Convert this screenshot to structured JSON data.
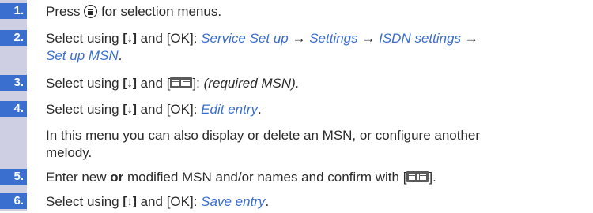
{
  "steps": [
    {
      "num": "1.",
      "before": "Press",
      "after": "for selection menus."
    },
    {
      "num": "2.",
      "lead": "Select using",
      "key_ok": "[OK]:",
      "p1": "Service Set up",
      "arrow": "→",
      "p2": "Settings",
      "p3": "ISDN settings",
      "p4": "Set up MSN",
      "period": "."
    },
    {
      "num": "3.",
      "lead": "Select using",
      "and": "and",
      "tail": "(required MSN)."
    },
    {
      "num": "4.",
      "lead": "Select using",
      "key_ok": "[OK]:",
      "item": "Edit entry",
      "period": "."
    },
    {
      "note_line1": "In this menu you can also display or delete an MSN, or configure another",
      "note_line2": "melody."
    },
    {
      "num": "5.",
      "before": "Enter new",
      "bold": "or",
      "after": "modified MSN and/or names and confirm with"
    },
    {
      "num": "6.",
      "lead": "Select using",
      "key_ok": "[OK]:",
      "item": "Save entry",
      "period": "."
    }
  ],
  "glyphs": {
    "down_key": "[↓]",
    "bracket_open": "[",
    "bracket_close": "]",
    "and": "and"
  },
  "icons": [
    "menu-key-icon",
    "down-arrow-key-icon",
    "display-softkey-icon"
  ],
  "colors": {
    "number_box": "#3a6fd0",
    "rail": "#cfcfe3",
    "menu_path": "#3a6fd0"
  }
}
